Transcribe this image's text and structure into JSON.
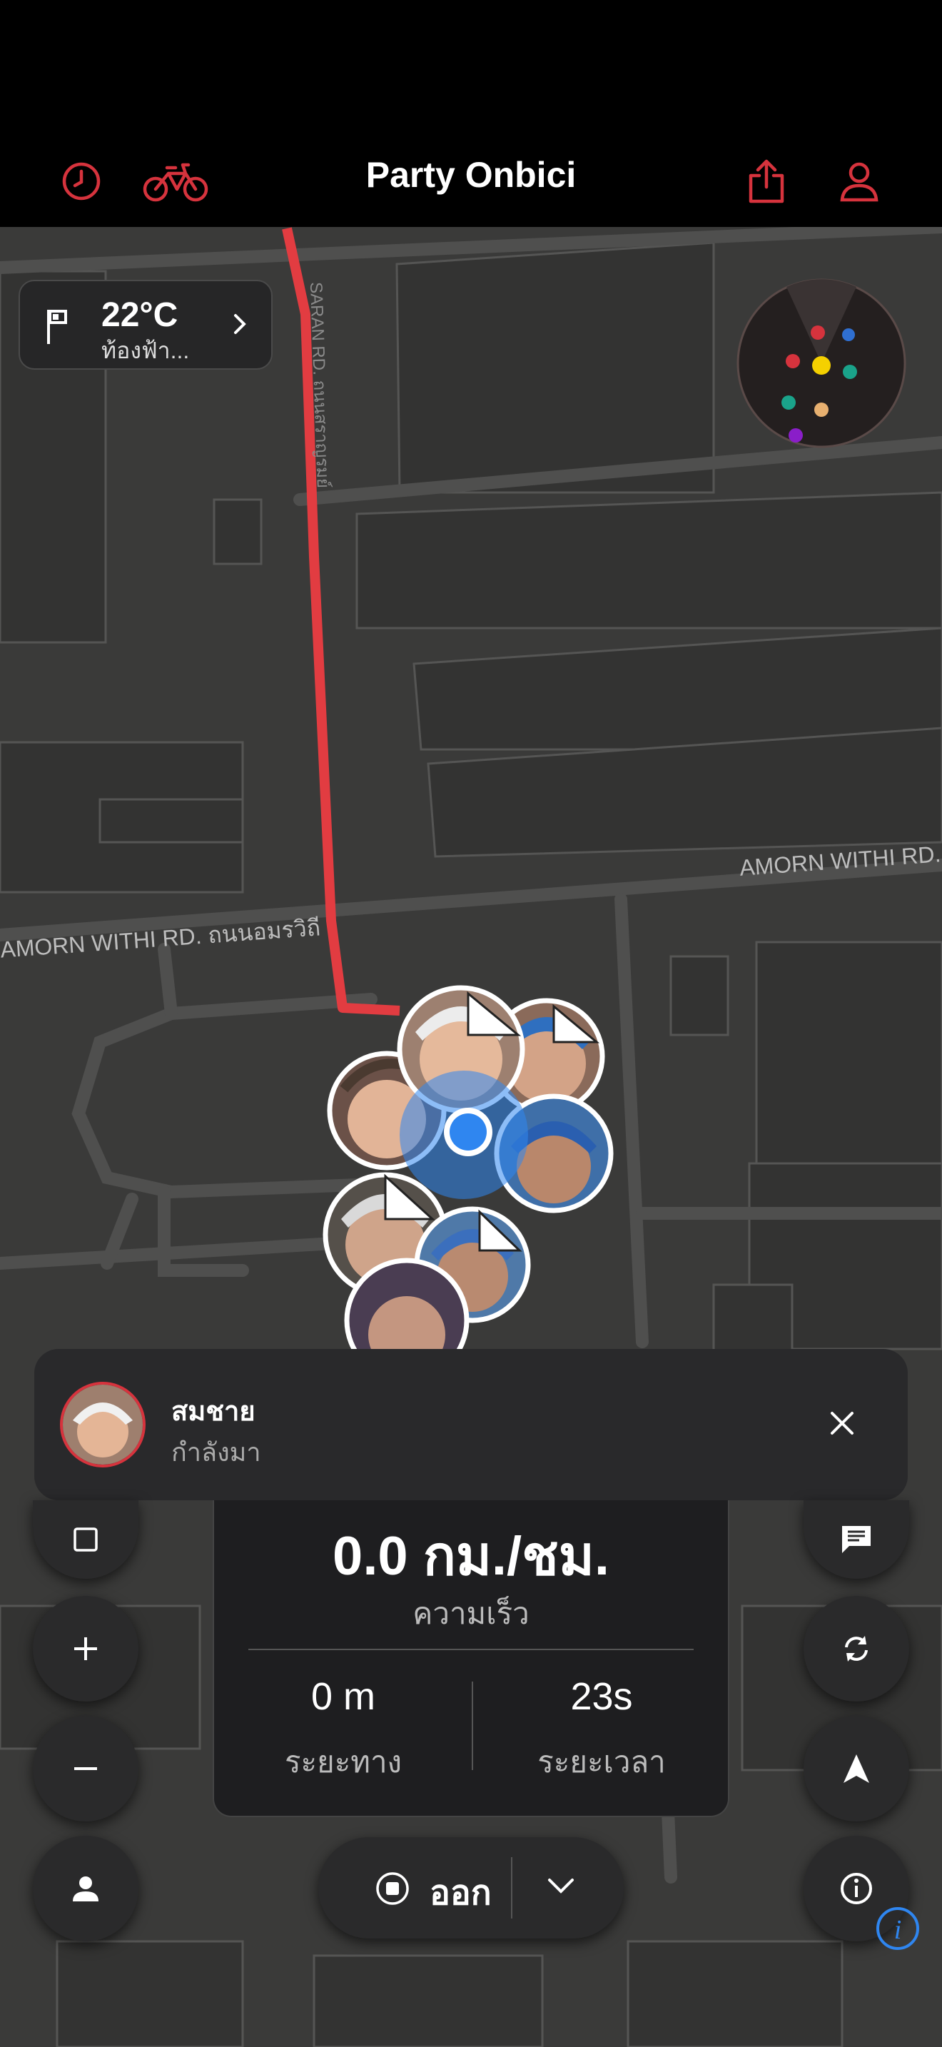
{
  "app": {
    "title": "Party Onbici"
  },
  "topbar_icons": {
    "left": [
      "history-icon",
      "bike-icon"
    ],
    "right": [
      "share-icon",
      "profile-icon"
    ]
  },
  "weather": {
    "temperature": "22°C",
    "condition": "ท้องฟ้า..."
  },
  "map": {
    "roads": [
      {
        "name": "AMORN WITHI RD."
      },
      {
        "name": "AMORN WITHI RD. ถนนอมรวิถี"
      },
      {
        "name": "SARAN RD. ถนนสราญรมย์"
      }
    ]
  },
  "radar_dots": [
    {
      "color": "#d6333d"
    },
    {
      "color": "#2f6fd1"
    },
    {
      "color": "#d6333d"
    },
    {
      "color": "#f5d000"
    },
    {
      "color": "#1aa38a"
    },
    {
      "color": "#1aa38a"
    },
    {
      "color": "#e8b070"
    },
    {
      "color": "#8a1ec9"
    }
  ],
  "notification": {
    "name": "สมชาย",
    "status": "กำลังมา"
  },
  "stats": {
    "speed": "0.0 กม./ชม.",
    "speed_label": "ความเร็ว",
    "distance": "0 m",
    "distance_label": "ระยะทาง",
    "duration": "23s",
    "duration_label": "ระยะเวลา"
  },
  "controls": {
    "stop_label": "ออก",
    "left_fabs": [
      "square-icon",
      "zoom-in-icon",
      "zoom-out-icon",
      "person-icon"
    ],
    "right_fabs": [
      "chat-icon",
      "sync-icon",
      "navigation-arrow-icon",
      "info-icon"
    ]
  },
  "colors": {
    "accent": "#d6333d",
    "location_blue": "#2f86f0"
  }
}
